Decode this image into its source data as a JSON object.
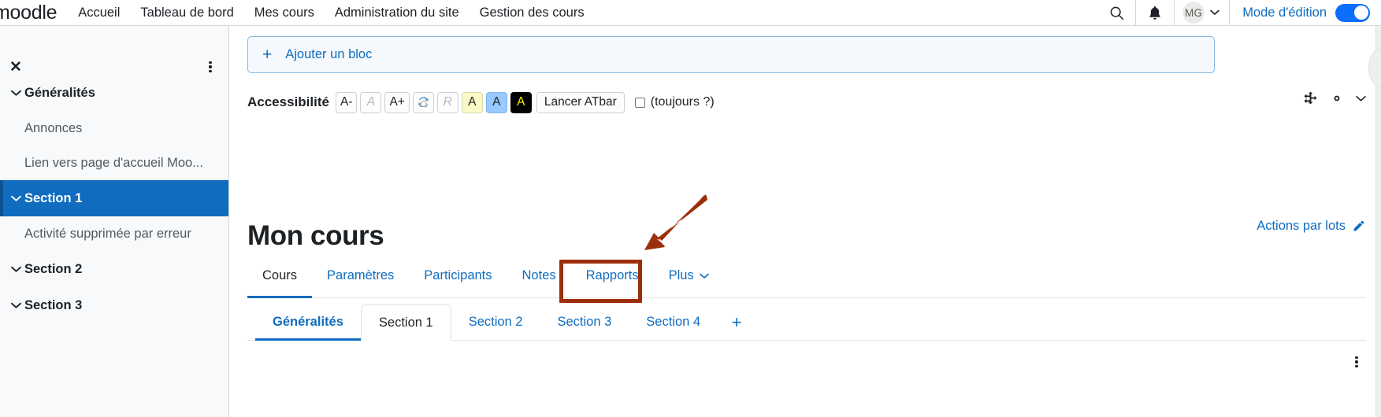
{
  "header": {
    "brand": "moodle",
    "nav": [
      {
        "label": "Accueil"
      },
      {
        "label": "Tableau de bord"
      },
      {
        "label": "Mes cours"
      },
      {
        "label": "Administration du site"
      },
      {
        "label": "Gestion des cours"
      }
    ],
    "search_icon": "search-icon",
    "notifications_icon": "bell-icon",
    "avatar_initials": "MG",
    "edit_mode_label": "Mode d'édition",
    "edit_mode_on": true,
    "accent_color": "#0f6cbf",
    "toggle_color": "#0d6efd"
  },
  "sidebar": {
    "close_label": "✕",
    "items": [
      {
        "label": "Généralités",
        "type": "section",
        "active": false,
        "expanded": true
      },
      {
        "label": "Annonces",
        "type": "activity"
      },
      {
        "label": "Lien vers page d'accueil Moo...",
        "type": "activity"
      },
      {
        "label": "Section 1",
        "type": "section",
        "active": true,
        "expanded": true
      },
      {
        "label": "Activité supprimée par erreur",
        "type": "activity"
      },
      {
        "label": "Section 2",
        "type": "section",
        "active": false,
        "expanded": true
      },
      {
        "label": "Section 3",
        "type": "section",
        "active": false,
        "expanded": true
      }
    ],
    "active_bg": "#0f6cbf"
  },
  "main": {
    "add_block": {
      "plus": "+",
      "label": "Ajouter un bloc"
    },
    "accessibility": {
      "title": "Accessibilité",
      "buttons": [
        {
          "label": "A-",
          "name": "decrease-font-size",
          "style": "normal"
        },
        {
          "label": "A",
          "name": "reset-font-size",
          "style": "muted"
        },
        {
          "label": "A+",
          "name": "increase-font-size",
          "style": "normal"
        },
        {
          "label": "",
          "name": "reset-settings-icon",
          "style": "icon"
        },
        {
          "label": "R",
          "name": "reset-color",
          "style": "muted"
        },
        {
          "label": "A",
          "name": "color-scheme-yellow",
          "style": "yellow"
        },
        {
          "label": "A",
          "name": "color-scheme-blue",
          "style": "blue"
        },
        {
          "label": "A",
          "name": "color-scheme-black",
          "style": "black"
        }
      ],
      "launch_label": "Lancer ATbar",
      "always_label": "(toujours ?)",
      "always_checked": false,
      "actions": [
        "move-icon",
        "gear-icon",
        "chevron-down-icon"
      ]
    },
    "course_title": "Mon cours",
    "bulk_actions_label": "Actions par lots",
    "bulk_actions_icon": "pencil-icon",
    "course_tabs": [
      {
        "label": "Cours",
        "active": true,
        "has_caret": false
      },
      {
        "label": "Paramètres",
        "active": false,
        "has_caret": false,
        "annotated": true
      },
      {
        "label": "Participants",
        "active": false,
        "has_caret": false
      },
      {
        "label": "Notes",
        "active": false,
        "has_caret": false
      },
      {
        "label": "Rapports",
        "active": false,
        "has_caret": false
      },
      {
        "label": "Plus",
        "active": false,
        "has_caret": true,
        "caret": "⌄"
      }
    ],
    "section_tabs": [
      {
        "label": "Généralités",
        "state": "link-active"
      },
      {
        "label": "Section 1",
        "state": "selected"
      },
      {
        "label": "Section 2",
        "state": "link"
      },
      {
        "label": "Section 3",
        "state": "link"
      },
      {
        "label": "Section 4",
        "state": "link"
      }
    ],
    "section_add_label": "+",
    "bottom_menu_icon": "kebab-menu-icon"
  },
  "annotation": {
    "color": "#9c2f0b",
    "target_tab": "Paramètres",
    "shape": "arrow-pointing-down-left"
  }
}
